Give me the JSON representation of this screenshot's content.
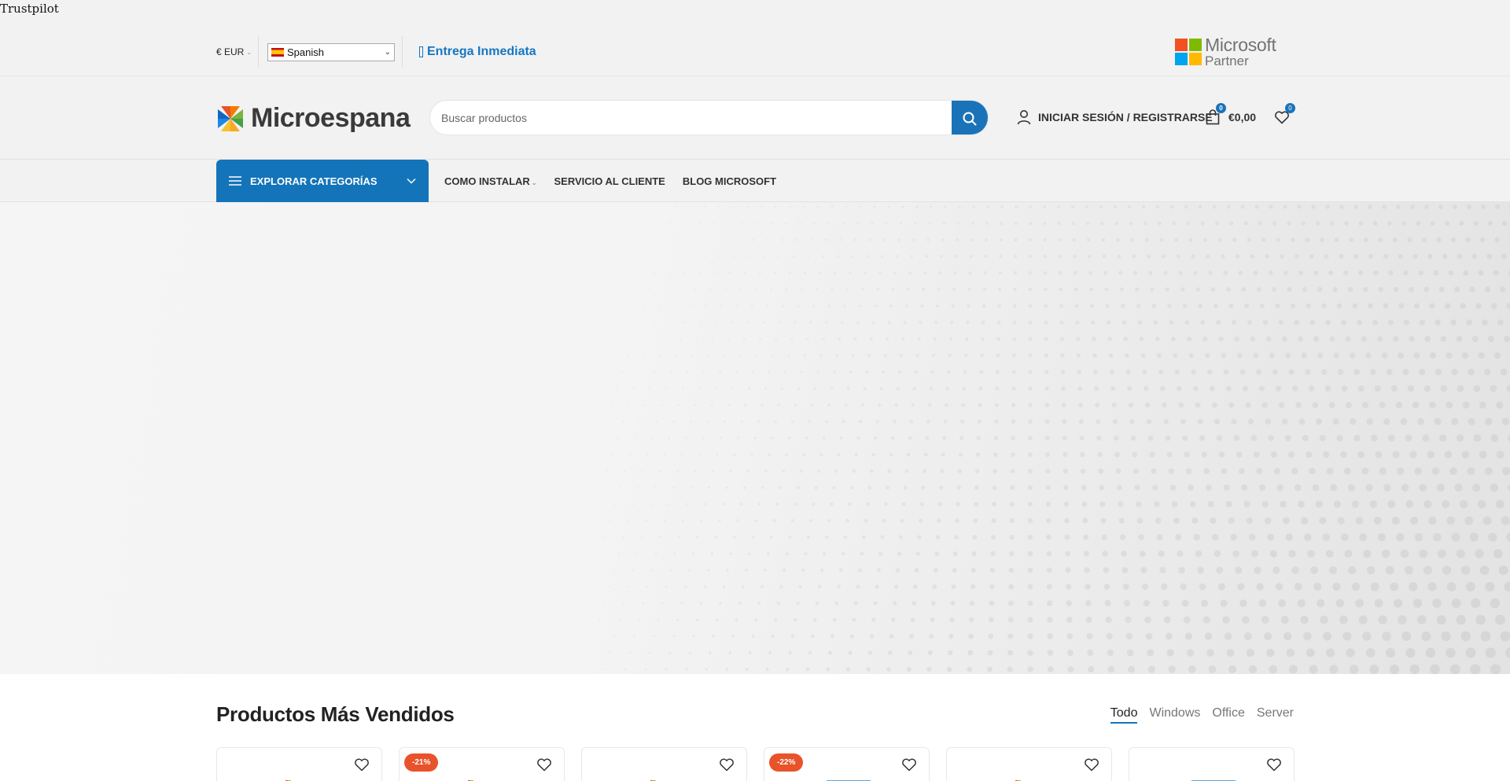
{
  "trustpilot": "Trustpilot",
  "topbar": {
    "currency": "€ EUR",
    "language": {
      "selected": "Spanish"
    },
    "delivery": "Entrega Inmediata",
    "partner": {
      "line1": "Microsoft",
      "line2": "Partner"
    }
  },
  "header": {
    "logo_text": "Microespana",
    "search": {
      "placeholder": "Buscar productos",
      "value": ""
    },
    "account_label": "INICIAR SESIÓN / REGISTRARSE",
    "cart": {
      "count": "0",
      "total": "€0,00"
    },
    "wishlist": {
      "count": "0"
    }
  },
  "nav": {
    "categories_label": "EXPLORAR CATEGORÍAS",
    "links": [
      "COMO INSTALAR",
      "SERVICIO AL CLIENTE",
      "BLOG MICROSOFT"
    ]
  },
  "products_section": {
    "title": "Productos Más Vendidos",
    "tabs": [
      "Todo",
      "Windows",
      "Office",
      "Server"
    ],
    "active_tab": "Todo"
  },
  "products": [
    {
      "discount": ""
    },
    {
      "discount": "-21%"
    },
    {
      "discount": ""
    },
    {
      "discount": "-22%"
    },
    {
      "discount": ""
    },
    {
      "discount": ""
    }
  ],
  "colors": {
    "brand_blue": "#1474ba",
    "discount_orange": "#e8532b",
    "delivery_blue": "#1577c1"
  }
}
